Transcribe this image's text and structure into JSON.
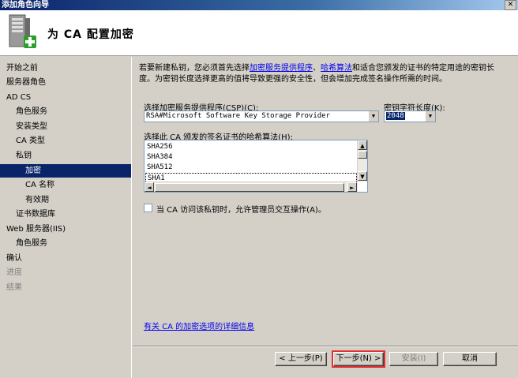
{
  "window": {
    "title": "添加角色向导",
    "close_glyph": "✕"
  },
  "header": {
    "heading": "为 CA 配置加密",
    "icon": "server-add-icon"
  },
  "nav": {
    "items": [
      {
        "label": "开始之前",
        "state": "normal"
      },
      {
        "label": "服务器角色",
        "state": "normal"
      },
      {
        "label": "AD CS",
        "state": "normal"
      },
      {
        "label": "角色服务",
        "state": "normal"
      },
      {
        "label": "安装类型",
        "state": "normal"
      },
      {
        "label": "CA 类型",
        "state": "normal"
      },
      {
        "label": "私钥",
        "state": "normal"
      },
      {
        "label": "加密",
        "state": "selected"
      },
      {
        "label": "CA 名称",
        "state": "normal"
      },
      {
        "label": "有效期",
        "state": "normal"
      },
      {
        "label": "证书数据库",
        "state": "normal"
      },
      {
        "label": "Web 服务器(IIS)",
        "state": "normal"
      },
      {
        "label": "角色服务",
        "state": "normal"
      },
      {
        "label": "确认",
        "state": "normal"
      },
      {
        "label": "进度",
        "state": "disabled"
      },
      {
        "label": "结果",
        "state": "disabled"
      }
    ]
  },
  "content": {
    "intro_part1": "若要新建私钥，您必须首先选择",
    "intro_link1": "加密服务提供程序",
    "intro_part2": "、",
    "intro_link2": "哈希算法",
    "intro_part3": "和适合您颁发的证书的特定用途的密钥长度。为密钥长度选择更高的值将导致更强的安全性，但会增加完成签名操作所需的时间。",
    "csp_label": "选择加密服务提供程序(CSP)(C):",
    "csp_value": "RSA#Microsoft Software Key Storage Provider",
    "keylen_label": "密钥字符长度(K):",
    "keylen_value": "2048",
    "hash_label": "选择此 CA 颁发的签名证书的哈希算法(H):",
    "hash_options": [
      "SHA256",
      "SHA384",
      "SHA512",
      "SHA1"
    ],
    "checkbox_label": "当 CA 访问该私钥时，允许管理员交互操作(A)。",
    "checkbox_checked": false,
    "more_info_link": "有关 CA 的加密选项的详细信息"
  },
  "buttons": {
    "back": "< 上一步(P)",
    "next": "下一步(N) >",
    "install": "安装(I)",
    "cancel": "取消"
  },
  "colors": {
    "selection": "#0a246a",
    "link": "#0000ee",
    "highlight_outline": "#e03030"
  }
}
